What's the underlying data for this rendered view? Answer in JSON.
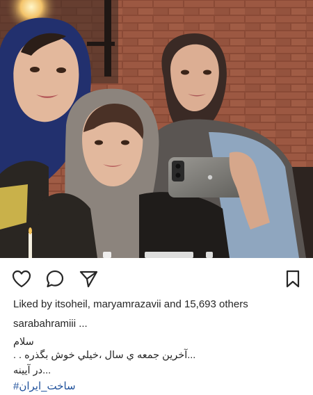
{
  "post": {
    "likes_prefix": "Liked by ",
    "liker_1": "itsoheil",
    "separator": ", ",
    "liker_2": "maryamrazavii",
    "likes_suffix": " and 15,693 others",
    "caption_user": "sarabahramiii ...",
    "caption_lines": [
      "سلام",
      ". . آخرین جمعه ي سال ،خيلي خوش بگذره...",
      "در آيينه..."
    ],
    "hashtag": "#ساخت_ایران"
  },
  "icons": {
    "like": "heart-outline-icon",
    "comment": "speech-bubble-icon",
    "share": "paper-plane-icon",
    "save": "bookmark-icon"
  },
  "colors": {
    "text": "#262626",
    "hashtag": "#1d4f9a",
    "background": "#ffffff"
  }
}
